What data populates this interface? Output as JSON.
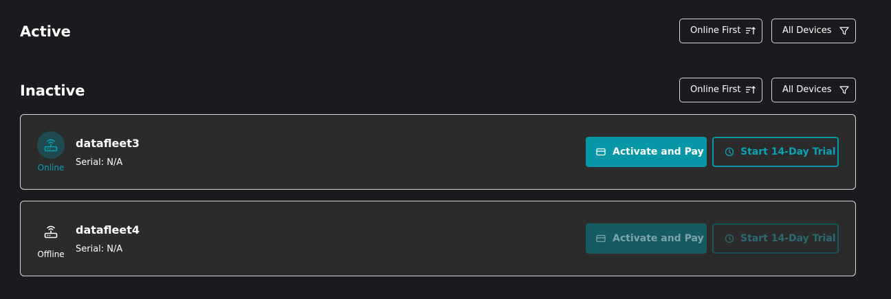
{
  "sections": {
    "active": {
      "title": "Active",
      "sort_label": "Online First",
      "filter_label": "All Devices"
    },
    "inactive": {
      "title": "Inactive",
      "sort_label": "Online First",
      "filter_label": "All Devices"
    }
  },
  "devices": [
    {
      "name": "datafleet3",
      "serial": "Serial: N/A",
      "status": "Online",
      "icon": "router-wifi-icon",
      "activate_label": "Activate and Pay",
      "trial_label": "Start 14-Day Trial",
      "enabled": true
    },
    {
      "name": "datafleet4",
      "serial": "Serial: N/A",
      "status": "Offline",
      "icon": "router-wifi-icon",
      "activate_label": "Activate and Pay",
      "trial_label": "Start 14-Day Trial",
      "enabled": false
    }
  ],
  "colors": {
    "background": "#1b1b1f",
    "card": "#2b2b2b",
    "accent": "#0797a6",
    "online": "#0aa2b5"
  }
}
